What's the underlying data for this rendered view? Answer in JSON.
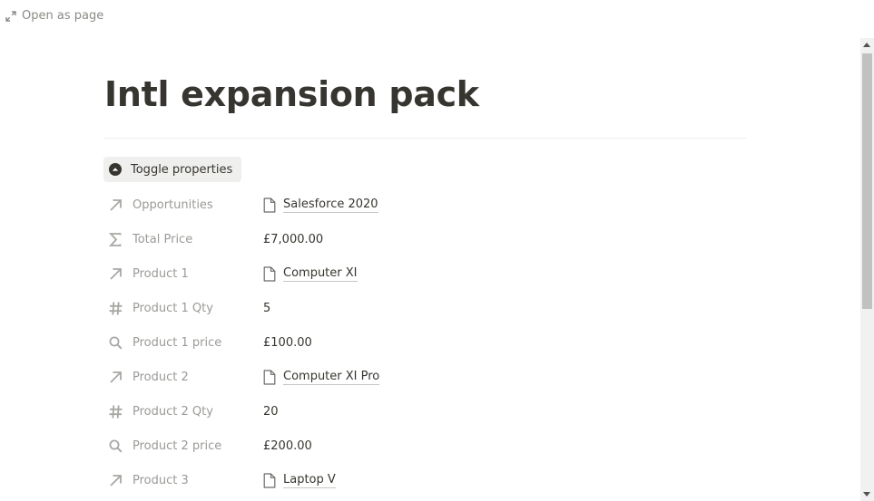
{
  "header": {
    "open_as_page": "Open as page"
  },
  "page": {
    "title": "Intl expansion pack"
  },
  "toggle": {
    "label": "Toggle properties"
  },
  "properties": [
    {
      "name": "Opportunities",
      "icon": "relation-arrow-icon",
      "value": "Salesforce 2020",
      "value_type": "relation"
    },
    {
      "name": "Total Price",
      "icon": "sigma-icon",
      "value": "£7,000.00",
      "value_type": "text"
    },
    {
      "name": "Product 1",
      "icon": "relation-arrow-icon",
      "value": "Computer XI",
      "value_type": "relation"
    },
    {
      "name": "Product 1 Qty",
      "icon": "hash-icon",
      "value": "5",
      "value_type": "text"
    },
    {
      "name": "Product 1 price",
      "icon": "search-icon",
      "value": "£100.00",
      "value_type": "text"
    },
    {
      "name": "Product 2",
      "icon": "relation-arrow-icon",
      "value": "Computer XI Pro",
      "value_type": "relation"
    },
    {
      "name": "Product 2 Qty",
      "icon": "hash-icon",
      "value": "20",
      "value_type": "text"
    },
    {
      "name": "Product 2 price",
      "icon": "search-icon",
      "value": "£200.00",
      "value_type": "text"
    },
    {
      "name": "Product 3",
      "icon": "relation-arrow-icon",
      "value": "Laptop V",
      "value_type": "relation"
    }
  ],
  "colors": {
    "text": "#37352f",
    "muted": "#9b9a97",
    "toggle_bg": "#efefee"
  }
}
